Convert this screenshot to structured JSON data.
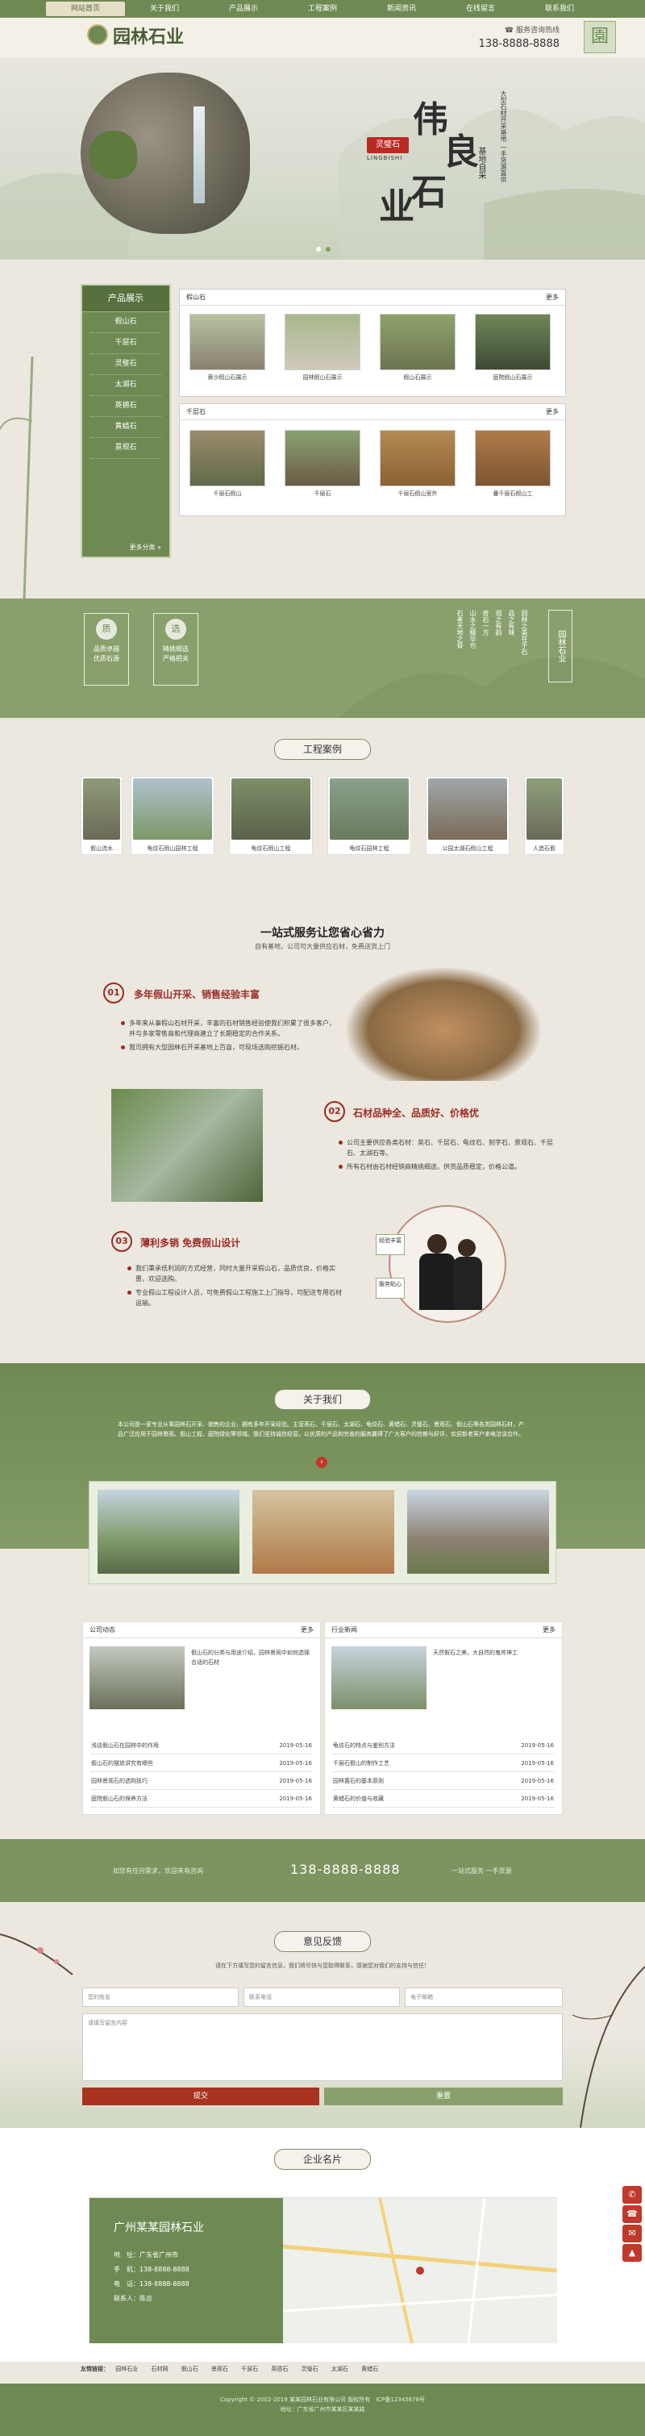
{
  "nav": {
    "items": [
      {
        "label": "网站首页",
        "active": true
      },
      {
        "label": "关于我们"
      },
      {
        "label": "产品展示"
      },
      {
        "label": "工程案例"
      },
      {
        "label": "新闻资讯"
      },
      {
        "label": "在线留言"
      },
      {
        "label": "联系我们"
      }
    ]
  },
  "header": {
    "logo_text": "园林石业",
    "contact_label": "服务咨询热线",
    "phone": "138-8888-8888",
    "wechat_glyph": "園"
  },
  "banner": {
    "big_chars": [
      "伟",
      "良",
      "石",
      "业"
    ],
    "seal": "灵璧石",
    "pinyin": "LINGBISHI",
    "slogan": "基地自采",
    "side_text": "大型石材开采基地 一手货源直供"
  },
  "products": {
    "sidebar_title": "产品展示",
    "categories": [
      "假山石",
      "千层石",
      "灵璧石",
      "太湖石",
      "英德石",
      "黄蜡石",
      "景观石"
    ],
    "more": "更多分类 »",
    "group1": {
      "title": "假山石",
      "more": "更多",
      "items": [
        "黄沙假山石展示",
        "园林假山石展示",
        "假山石展示",
        "庭院假山石展示"
      ]
    },
    "group2": {
      "title": "千层石",
      "more": "更多",
      "items": [
        "千层石假山",
        "千层石",
        "千层石假山室外",
        "叠千层石假山工"
      ]
    }
  },
  "features": [
    {
      "icon": "质",
      "text": "品质卓越 优质石源"
    },
    {
      "icon": "选",
      "text": "精挑细选 严格把关"
    }
  ],
  "poem": {
    "title": "园林石业",
    "lines": [
      "石者天地之骨",
      "山水之精华也",
      "奇石一方",
      "观之有韵",
      "品之有味",
      "园林之美在于石"
    ]
  },
  "cases": {
    "title": "工程案例",
    "items": [
      "假山流水",
      "龟纹石假山园林工程",
      "龟纹石假山工程",
      "龟纹石园林工程",
      "公园太湖石假山工程",
      "人造石假"
    ]
  },
  "service": {
    "title": "一站式服务让您省心省力",
    "subtitle": "自有基地，公司可大量供应石材，免费送货上门",
    "f1": {
      "num": "01",
      "title": "多年假山开采、销售经验丰富",
      "points": [
        "多年来从事假山石材开采，丰富的石材销售经验使我们积累了很多客户，并与多家零售商和代理商建立了长期稳定的合作关系。",
        "我司拥有大型园林石开采基地上百亩，可现场选购挖掘石材。"
      ]
    },
    "f2": {
      "num": "02",
      "title": "石材品种全、品质好、价格优",
      "points": [
        "公司主要供应各类石材：英石、千层石、龟纹石、刻字石、景观石、千层石、太湖石等。",
        "所有石材由石材经销商精挑细选，供货品质稳定，价格公道。"
      ]
    },
    "f3": {
      "num": "03",
      "title": "薄利多销 免费假山设计",
      "points": [
        "我们秉承低利润的方式经营，同时大量开采假山石，品质优良，价格实惠，欢迎选购。",
        "专业假山工程设计人员，可免费假山工程施工上门指导，可配送专用石材运输。"
      ]
    },
    "badges": [
      "经验丰富",
      "服务贴心"
    ]
  },
  "about": {
    "title": "关于我们",
    "text": "本公司是一家专业从事园林石开采、销售的企业，拥有多年开采经验。主营英石、千层石、太湖石、龟纹石、黄蜡石、灵璧石、景观石、假山石等各类园林石材，产品广泛应用于园林景观、假山工程、庭院绿化等领域。我们坚持诚信经营，以优质的产品和完善的服务赢得了广大客户的信赖与好评，欢迎新老客户来电洽谈合作。"
  },
  "news": {
    "company": {
      "title": "公司动态",
      "more": "更多",
      "featured": "假山石的分类与用途介绍，园林景观中如何选择合适的石材",
      "rows": [
        {
          "t": "浅谈假山石在园林中的作用",
          "d": "2019-05-16"
        },
        {
          "t": "假山石的摆放讲究有哪些",
          "d": "2019-05-16"
        },
        {
          "t": "园林景观石的选购技巧",
          "d": "2019-05-16"
        },
        {
          "t": "庭院假山石的保养方法",
          "d": "2019-05-16"
        }
      ]
    },
    "industry": {
      "title": "行业新闻",
      "more": "更多",
      "featured": "天然假石之美，大自然的鬼斧神工",
      "rows": [
        {
          "t": "龟纹石的特点与鉴别方法",
          "d": "2019-05-16"
        },
        {
          "t": "千层石假山的制作工艺",
          "d": "2019-05-16"
        },
        {
          "t": "园林置石的基本原则",
          "d": "2019-05-16"
        },
        {
          "t": "黄蜡石的价值与收藏",
          "d": "2019-05-16"
        }
      ]
    }
  },
  "hotline": {
    "left": "如您有任何需求，欢迎来电咨询",
    "phone": "138-8888-8888",
    "right": "一站式服务 一手货源"
  },
  "feedback": {
    "title": "意见反馈",
    "intro": "请在下方填写您的留言信息，我们将尽快与您取得联系，感谢您对我们的支持与信任！",
    "name_ph": "您的姓名",
    "phone_ph": "联系电话",
    "email_ph": "电子邮箱",
    "content_ph": "请填写留言内容",
    "submit": "提交",
    "reset": "重置"
  },
  "card": {
    "title": "企业名片",
    "company": "广州某某园林石业",
    "address": "地　址：广东省广州市",
    "phone": "手　机：138-8888-8888",
    "tel": "电　话：138-8888-8888",
    "contact": "联系人：陈总"
  },
  "links": {
    "label": "友情链接：",
    "items": [
      "园林石业",
      "石材网",
      "假山石",
      "景观石",
      "千层石",
      "英德石",
      "灵璧石",
      "太湖石",
      "黄蜡石"
    ]
  },
  "footer": {
    "copyright": "Copyright © 2002-2019 某某园林石业有限公司 版权所有",
    "icp": "ICP备12345678号",
    "address": "地址：广东省广州市某某区某某路"
  },
  "colors": {
    "primary": "#6e8a52",
    "accent": "#9c2a22"
  }
}
